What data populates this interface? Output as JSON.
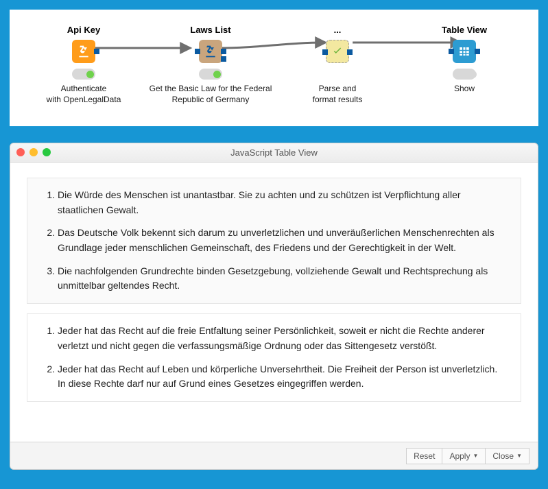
{
  "workflow": {
    "nodes": [
      {
        "title": "Api Key",
        "desc": "Authenticate\nwith OpenLegalData"
      },
      {
        "title": "Laws List",
        "desc": "Get the Basic Law for the Federal\nRepublic of Germany"
      },
      {
        "title": "...",
        "desc": "Parse and\nformat results"
      },
      {
        "title": "Table View",
        "desc": "Show"
      }
    ]
  },
  "window": {
    "title": "JavaScript Table View",
    "rows": [
      [
        "Die Würde des Menschen ist unantastbar. Sie zu achten und zu schützen ist Verpflichtung aller staatlichen Gewalt.",
        "Das Deutsche Volk bekennt sich darum zu unverletzlichen und unveräußerlichen Menschenrechten als Grundlage jeder menschlichen Gemeinschaft, des Friedens und der Gerechtigkeit in der Welt.",
        "Die nachfolgenden Grundrechte binden Gesetzgebung, vollziehende Gewalt und Rechtsprechung als unmittelbar geltendes Recht."
      ],
      [
        "Jeder hat das Recht auf die freie Entfaltung seiner Persönlichkeit, soweit er nicht die Rechte anderer verletzt und nicht gegen die verfassungsmäßige Ordnung oder das Sittengesetz verstößt.",
        "Jeder hat das Recht auf Leben und körperliche Unversehrtheit. Die Freiheit der Person ist unverletzlich. In diese Rechte darf nur auf Grund eines Gesetzes eingegriffen werden."
      ]
    ],
    "buttons": {
      "reset": "Reset",
      "apply": "Apply",
      "close": "Close"
    }
  }
}
